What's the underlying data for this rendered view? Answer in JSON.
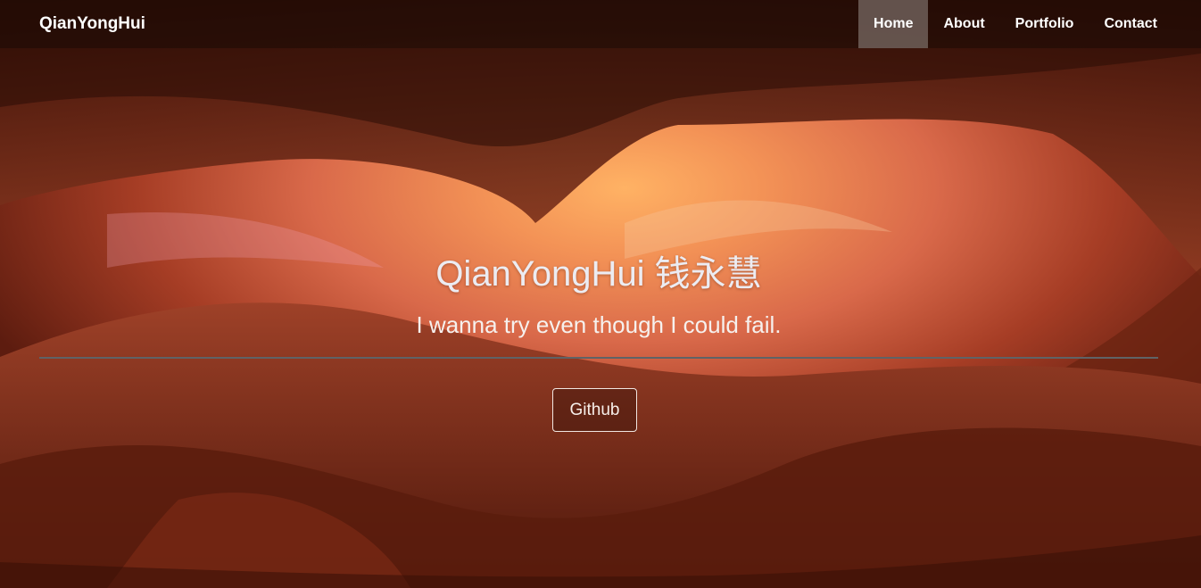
{
  "navbar": {
    "brand": "QianYongHui",
    "items": [
      {
        "label": "Home",
        "active": true
      },
      {
        "label": "About",
        "active": false
      },
      {
        "label": "Portfolio",
        "active": false
      },
      {
        "label": "Contact",
        "active": false
      }
    ]
  },
  "hero": {
    "title": "QianYongHui 钱永慧",
    "subtitle": "I wanna try even though I could fail.",
    "button_label": "Github",
    "background": "canyon-photo"
  },
  "colors": {
    "nav_active_bg": "#8c817c",
    "divider": "#5f6366",
    "text": "#ffffff"
  }
}
